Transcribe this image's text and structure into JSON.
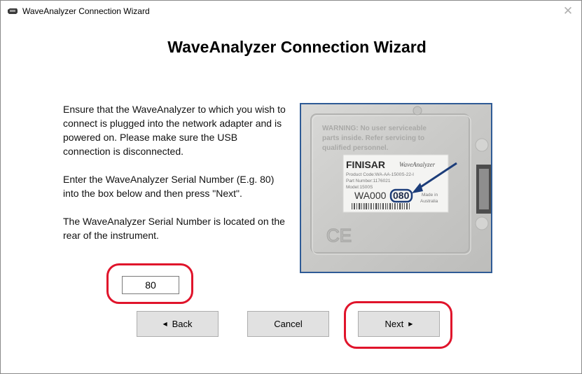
{
  "window": {
    "title": "WaveAnalyzer Connection Wizard"
  },
  "heading": "WaveAnalyzer Connection Wizard",
  "instructions": {
    "para1": "Ensure that the WaveAnalyzer to which you wish to connect is plugged into the network adapter and is powered on. Please make sure the USB connection is disconnected.",
    "para2": "Enter the WaveAnalyzer Serial Number (E.g. 80) into the box below and then press \"Next\".",
    "para3": "The WaveAnalyzer Serial Number is located on the rear of the instrument."
  },
  "serial_input": {
    "value": "80"
  },
  "buttons": {
    "back": "Back",
    "cancel": "Cancel",
    "next": "Next"
  },
  "photo": {
    "warning_line1": "WARNING: No user serviceable",
    "warning_line2": "parts inside.  Refer servicing to",
    "warning_line3": "qualified personnel.",
    "brand": "FINISAR",
    "product_name": "WaveAnalyzer",
    "product_code": "Product Code:WA-AA-1500S-22-I",
    "part_number": "Part Number:1176021",
    "model": "Model:1500S",
    "serial_prefix": "WA000",
    "serial_suffix": "080",
    "made_in_line1": "Made in",
    "made_in_line2": "Australia",
    "ce_mark": "CE"
  },
  "colors": {
    "highlight": "#e0142b",
    "photo_border": "#2f5b96",
    "button_face": "#e1e1e1"
  },
  "icons": {
    "app": "instrument-icon",
    "close": "close-icon",
    "back": "triangle-left-icon",
    "next": "triangle-right-icon"
  }
}
